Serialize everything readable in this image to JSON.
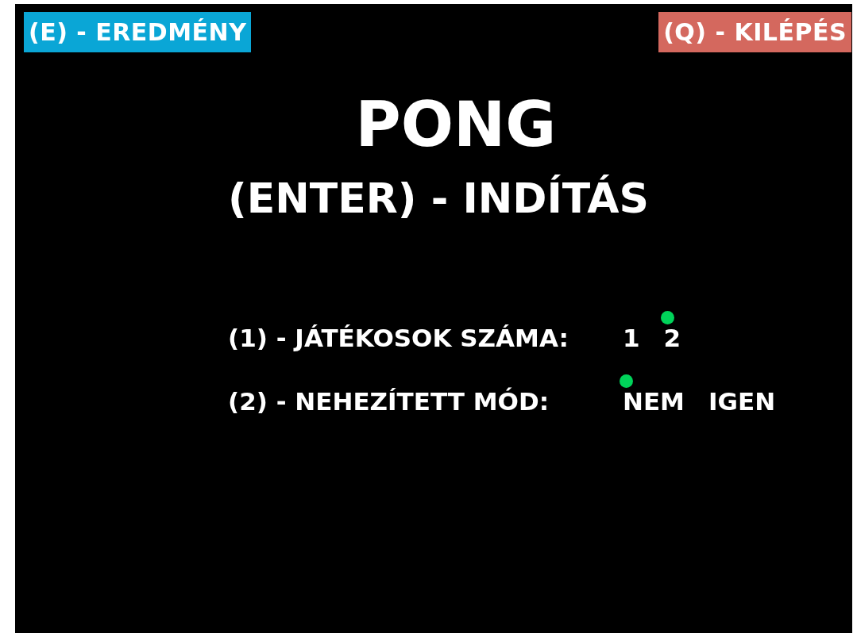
{
  "buttons": [
    {
      "label": "(E) - EREDMÉNY",
      "kind": "results"
    },
    {
      "label": "(Q) - KILÉPÉS",
      "kind": "quit"
    }
  ],
  "title": "PONG",
  "subtitle": "(ENTER) - INDÍTÁS",
  "options": [
    {
      "label": "(1) - JÁTÉKOSOK SZÁMA:",
      "choices": [
        {
          "label": "1",
          "selected": false
        },
        {
          "label": "2",
          "selected": true
        }
      ]
    },
    {
      "label": "(2) - NEHEZÍTETT MÓD:",
      "choices": [
        {
          "label": "NEM",
          "selected": true
        },
        {
          "label": "IGEN",
          "selected": false
        }
      ]
    }
  ]
}
